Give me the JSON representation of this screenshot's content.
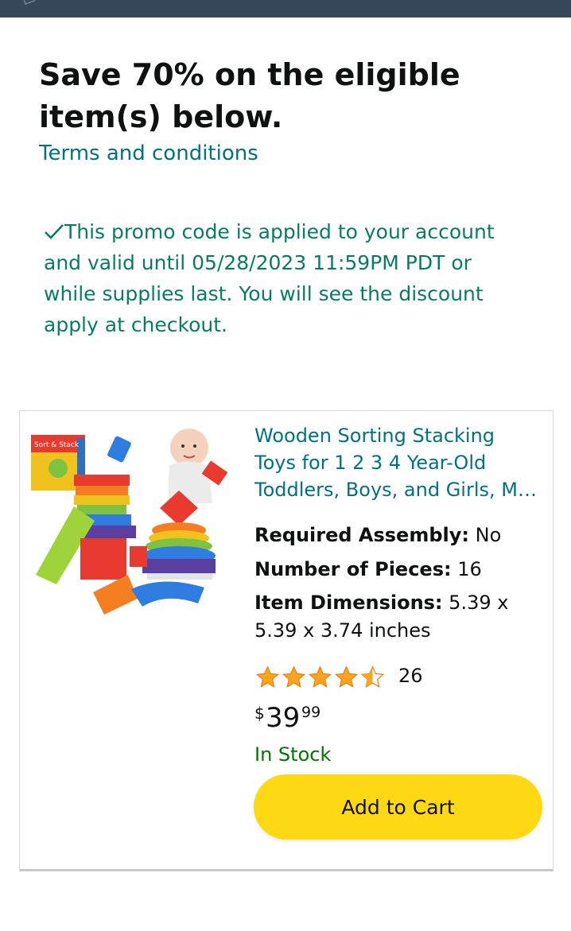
{
  "promo": {
    "headline_bold": "Save 70%",
    "headline_rest": " on the eligible item(s) below.",
    "terms_link": "Terms and conditions",
    "applied_message": "This promo code is applied to your account and valid until 05/28/2023 11:59PM PDT or while supplies last. You will see the discount apply at checkout."
  },
  "product": {
    "title": "Wooden Sorting Stacking Toys for 1 2 3 4 Year-Old Toddlers, Boys, and Girls, M…",
    "box_label": "Sort & Stack",
    "specs": [
      {
        "label": "Required Assembly:",
        "value": "No"
      },
      {
        "label": "Number of Pieces:",
        "value": "16"
      },
      {
        "label": "Item Dimensions:",
        "value": "5.39 x 5.39 x 3.74 inches"
      }
    ],
    "rating": 4.5,
    "rating_count": "26",
    "price_symbol": "$",
    "price_whole": "39",
    "price_fraction": "99",
    "availability": "In Stock",
    "add_to_cart_label": "Add to Cart"
  },
  "colors": {
    "link": "#007185",
    "promo_green": "#067d62",
    "stock_green": "#007600",
    "star": "#ffa41c",
    "button": "#ffd814",
    "topbar": "#37475a"
  },
  "icons": [
    "check-icon",
    "star-full-icon",
    "star-half-icon"
  ]
}
